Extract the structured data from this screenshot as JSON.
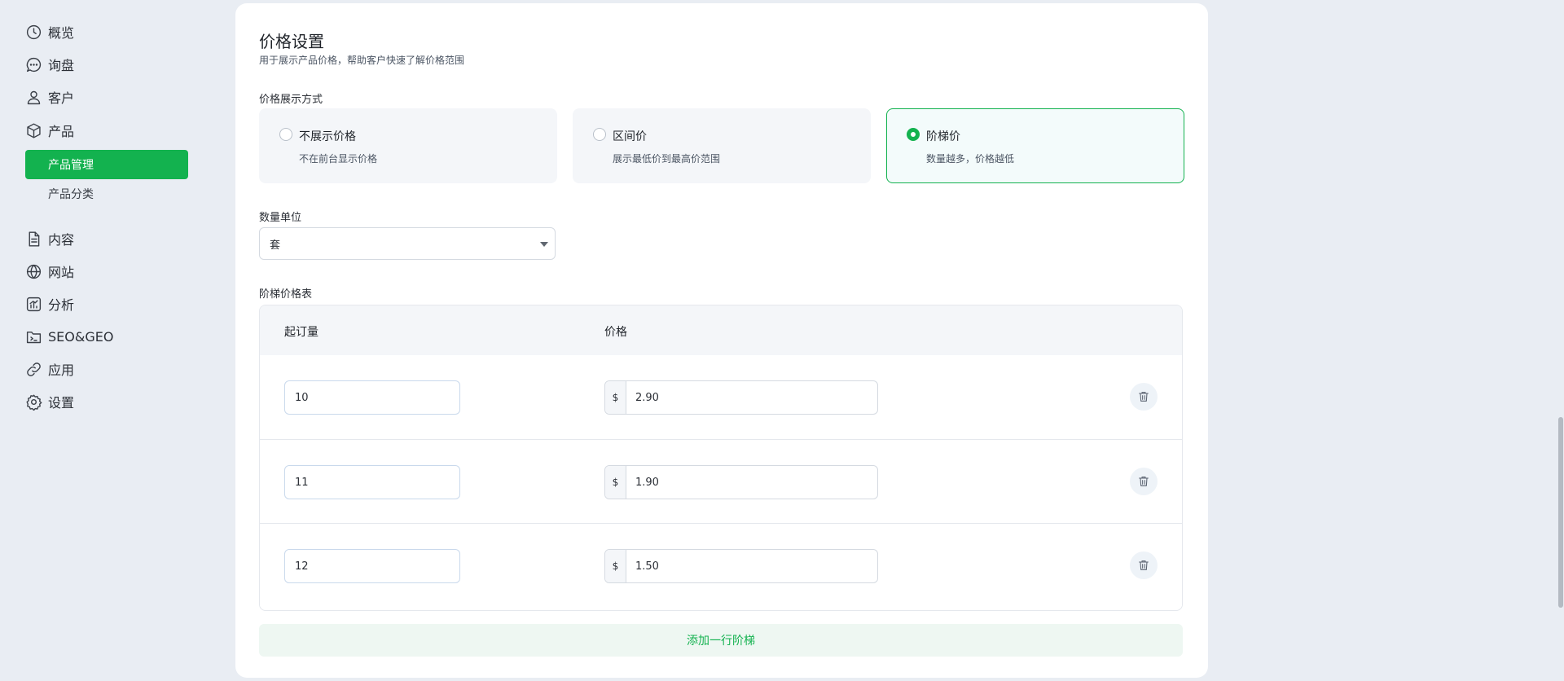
{
  "sidebar": {
    "items": [
      {
        "label": "概览",
        "icon": "clock-icon"
      },
      {
        "label": "询盘",
        "icon": "chat-bubble-icon"
      },
      {
        "label": "客户",
        "icon": "user-icon"
      },
      {
        "label": "产品",
        "icon": "box-icon"
      },
      {
        "label": "内容",
        "icon": "document-icon"
      },
      {
        "label": "网站",
        "icon": "globe-icon"
      },
      {
        "label": "分析",
        "icon": "chart-icon"
      },
      {
        "label": "SEO&GEO",
        "icon": "terminal-folder-icon"
      },
      {
        "label": "应用",
        "icon": "link-icon"
      },
      {
        "label": "设置",
        "icon": "gear-icon"
      }
    ],
    "sub_items": [
      {
        "label": "产品管理",
        "active": true
      },
      {
        "label": "产品分类",
        "active": false
      }
    ],
    "accent_color": "#13b24f"
  },
  "price_settings": {
    "title": "价格设置",
    "description": "用于展示产品价格，帮助客户快速了解价格范围",
    "display_mode_label": "价格展示方式",
    "options": [
      {
        "title": "不展示价格",
        "desc": "不在前台显示价格",
        "selected": false
      },
      {
        "title": "区间价",
        "desc": "展示最低价到最高价范围",
        "selected": false
      },
      {
        "title": "阶梯价",
        "desc": "数量越多，价格越低",
        "selected": true
      }
    ],
    "unit_label": "数量单位",
    "unit_value": "套",
    "tier_table_label": "阶梯价格表",
    "columns": [
      "起订量",
      "价格"
    ],
    "currency_symbol": "$",
    "rows": [
      {
        "min_qty": "10",
        "price": "2.90"
      },
      {
        "min_qty": "11",
        "price": "1.90"
      },
      {
        "min_qty": "12",
        "price": "1.50"
      }
    ],
    "add_row_label": "添加一行阶梯"
  }
}
